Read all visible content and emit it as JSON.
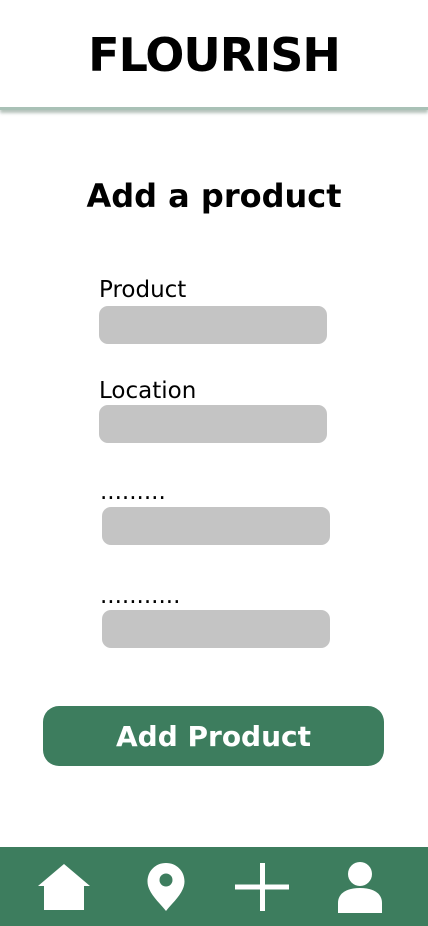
{
  "app": {
    "title": "FLOURISH"
  },
  "page": {
    "title": "Add a product"
  },
  "form": {
    "fields": [
      {
        "label": "Product",
        "value": "",
        "placeholder": ""
      },
      {
        "label": "Location",
        "value": "",
        "placeholder": ""
      },
      {
        "label": ".........",
        "value": "",
        "placeholder": ""
      },
      {
        "label": "...........",
        "value": "",
        "placeholder": ""
      }
    ],
    "submit_label": "Add Product"
  },
  "nav": {
    "items": [
      {
        "icon": "home-icon"
      },
      {
        "icon": "location-pin-icon"
      },
      {
        "icon": "plus-icon"
      },
      {
        "icon": "user-icon"
      }
    ]
  },
  "colors": {
    "accent": "#3d7d5e",
    "input_bg": "#c4c4c4",
    "header_shadow": "#a9c1b6",
    "text": "#000000",
    "icon": "#ffffff"
  }
}
